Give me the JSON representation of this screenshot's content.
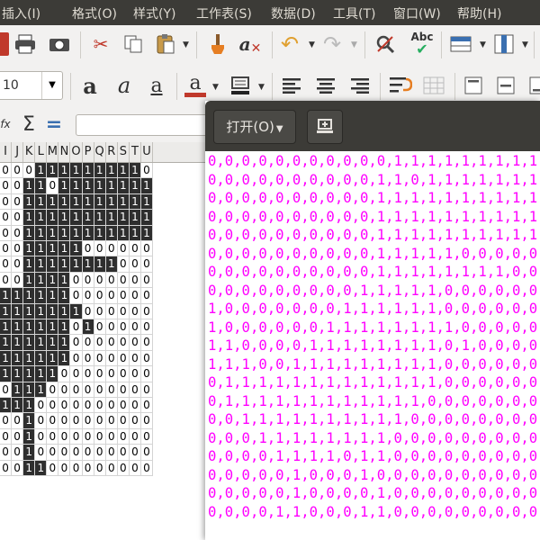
{
  "menu": [
    "插入(I)",
    "格式(O)",
    "样式(Y)",
    "工作表(S)",
    "数据(D)",
    "工具(T)",
    "窗口(W)",
    "帮助(H)"
  ],
  "toolbar": {
    "font_size": "10",
    "sum_symbol": "Σ",
    "equals_symbol": "=",
    "fx_label": "fx"
  },
  "sheet": {
    "columns": [
      "I",
      "J",
      "K",
      "L",
      "M",
      "N",
      "O",
      "P",
      "Q",
      "R",
      "S",
      "T",
      "U"
    ],
    "rows": [
      "0001111111110",
      "0011011111111",
      "0011111111111",
      "0011111111111",
      "0011111111111",
      "0011111000000",
      "0011111111000",
      "0011110000000",
      "1111110000000",
      "1111111000000",
      "1111110100000",
      "1111110000000",
      "1111110000000",
      "1111100000000",
      "0111000000000",
      "1110000000000",
      "0010000000000",
      "0010000000000",
      "0010000000000",
      "0011000000000"
    ]
  },
  "editor": {
    "open_label": "打开(O)",
    "lines": [
      "0,0,0,0,0,0,0,0,0,0,0,1,1,1,1,1,1,1,1,1,",
      "0,0,0,0,0,0,0,0,0,0,1,1,0,1,1,1,1,1,1,1,",
      "0,0,0,0,0,0,0,0,0,0,1,1,1,1,1,1,1,1,1,1,",
      "0,0,0,0,0,0,0,0,0,0,1,1,1,1,1,1,1,1,1,1,",
      "0,0,0,0,0,0,0,0,0,0,1,1,1,1,1,1,1,1,1,1,",
      "0,0,0,0,0,0,0,0,0,0,1,1,1,1,1,0,0,0,0,0,",
      "0,0,0,0,0,0,0,0,0,0,1,1,1,1,1,1,1,1,0,0,",
      "0,0,0,0,0,0,0,0,0,1,1,1,1,1,0,0,0,0,0,0,",
      "1,0,0,0,0,0,0,0,1,1,1,1,1,1,0,0,0,0,0,0,",
      "1,0,0,0,0,0,0,1,1,1,1,1,1,1,1,0,0,0,0,0,",
      "1,1,0,0,0,0,1,1,1,1,1,1,1,1,0,1,0,0,0,0,",
      "1,1,1,0,0,1,1,1,1,1,1,1,1,1,0,0,0,0,0,0,",
      "0,1,1,1,1,1,1,1,1,1,1,1,1,1,0,0,0,0,0,0,",
      "0,1,1,1,1,1,1,1,1,1,1,1,1,0,0,0,0,0,0,0,",
      "0,0,1,1,1,1,1,1,1,1,1,1,0,0,0,0,0,0,0,0,",
      "0,0,0,1,1,1,1,1,1,1,1,0,0,0,0,0,0,0,0,0,",
      "0,0,0,0,1,1,1,1,0,1,1,0,0,0,0,0,0,0,0,0,",
      "0,0,0,0,0,1,0,0,0,1,0,0,0,0,0,0,0,0,0,0,",
      "0,0,0,0,0,1,0,0,0,0,1,0,0,0,0,0,0,0,0,0,",
      "0,0,0,0,1,1,0,0,0,1,1,0,0,0,0,0,0,0,0,0,"
    ]
  }
}
